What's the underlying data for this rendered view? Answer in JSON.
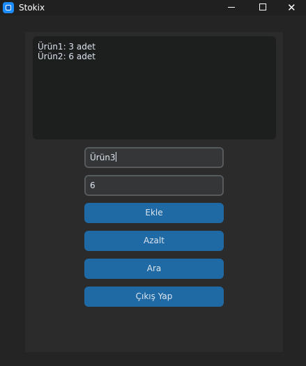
{
  "window": {
    "title": "Stokix"
  },
  "stock_list": {
    "lines": [
      "Ürün1: 3 adet",
      "Ürün2: 6 adet"
    ]
  },
  "product_input": {
    "value": "Ürün3"
  },
  "quantity_input": {
    "value": "6"
  },
  "buttons": {
    "add": "Ekle",
    "decrease": "Azalt",
    "search": "Ara",
    "exit": "Çıkış Yap"
  },
  "colors": {
    "background": "#242424",
    "panel": "#2b2b2b",
    "textbox": "#1d1e1e",
    "accent": "#1f6aa5",
    "text": "#dce4ee"
  }
}
